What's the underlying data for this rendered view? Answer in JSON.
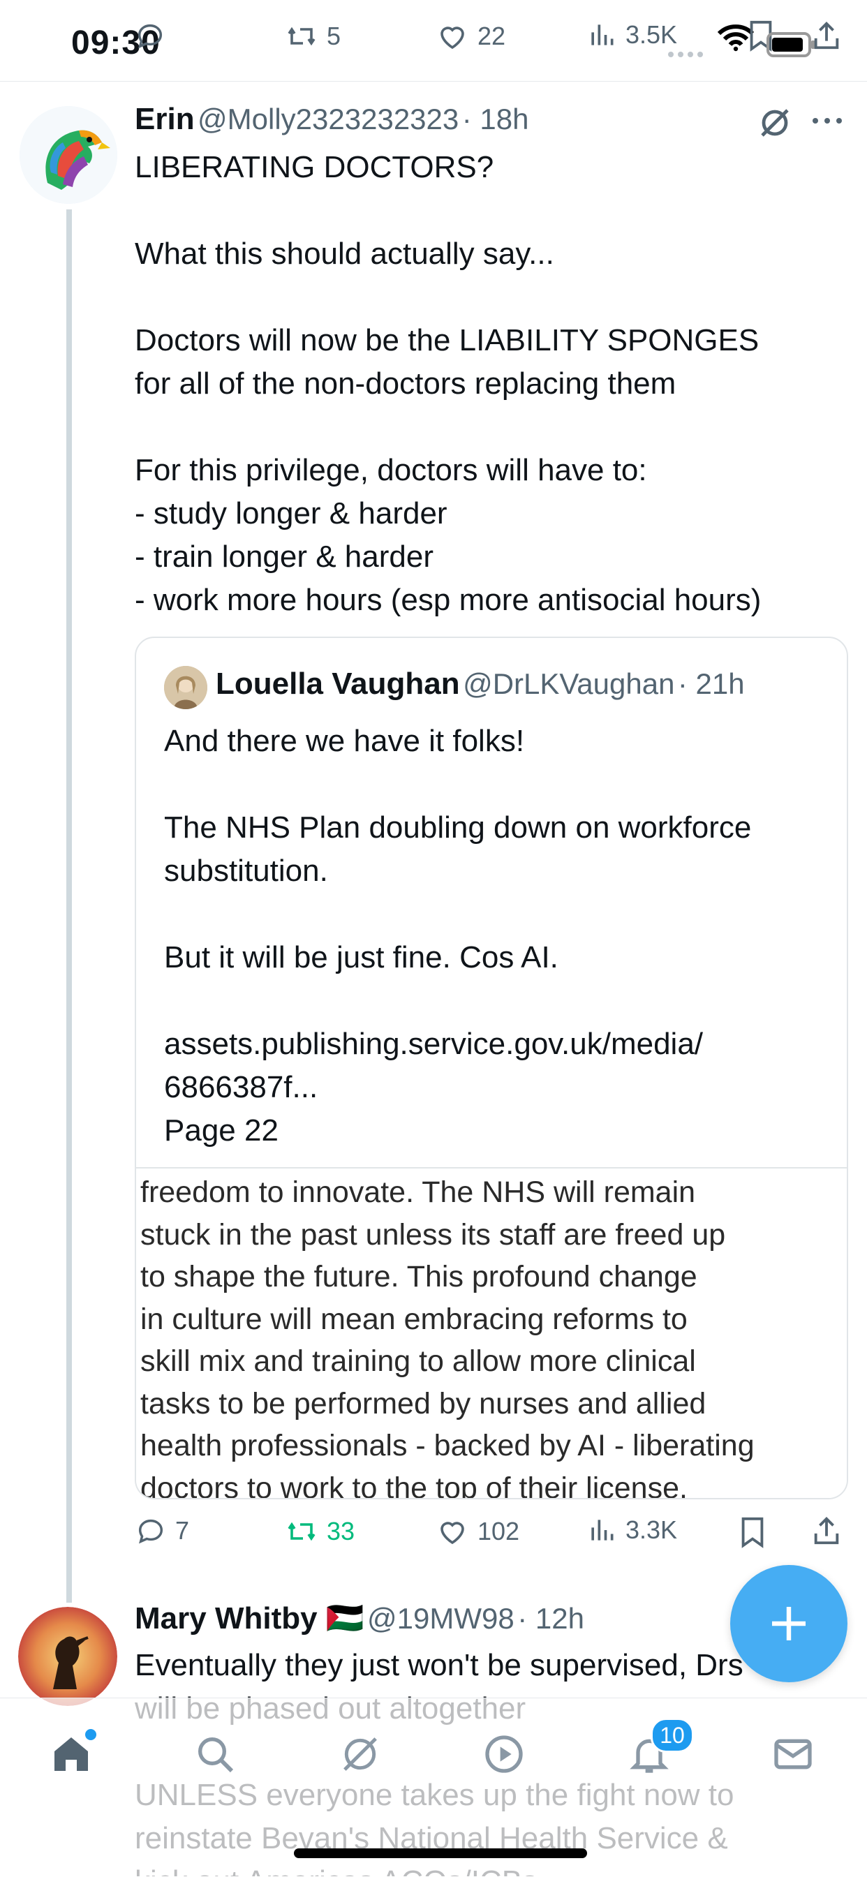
{
  "status_bar": {
    "time": "09:30"
  },
  "top_actions": {
    "retweets": "5",
    "likes": "22",
    "views": "3.5K"
  },
  "tweet": {
    "name": "Erin",
    "handle": "@Molly2323232323",
    "time": "· 18h",
    "text": "LIBERATING DOCTORS?\n\nWhat this should actually say...\n\nDoctors will now be the LIABILITY SPONGES\nfor all of the non-doctors replacing them\n\nFor this privilege, doctors will have to:\n- study longer & harder\n- train longer & harder\n- work more hours (esp more antisocial hours)",
    "quote": {
      "name": "Louella Vaughan",
      "handle": "@DrLKVaughan",
      "time": "· 21h",
      "text": "And there we have it folks!\n\nThe NHS Plan doubling down on workforce\nsubstitution.\n\nBut it will be just fine. Cos AI.\n\nassets.publishing.service.gov.uk/media/\n6866387f...\nPage 22",
      "image_text": "freedom to innovate. The NHS will remain\nstuck in the past unless its staff are freed up\nto shape the future. This profound change\nin culture will mean embracing reforms to\nskill mix and training to allow more clinical\ntasks to be performed by nurses and allied\nhealth professionals - backed by AI - liberating\ndoctors to work to the top of their license."
    },
    "actions": {
      "replies": "7",
      "retweets": "33",
      "likes": "102",
      "views": "3.3K"
    }
  },
  "reply": {
    "name": "Mary Whitby 🇵🇸",
    "handle": "@19MW98",
    "time": "· 12h",
    "text": "Eventually they just won't be supervised, Drs\nwill be phased out altogether\n\nUNLESS everyone takes up the fight now to\nreinstate Bevan's National Health Service &\nkick out Americas ACOs/ICBs"
  },
  "tabbar": {
    "notifications_badge": "10"
  },
  "colors": {
    "accent": "#1d9bf0",
    "retweet_green": "#00ba7c",
    "muted": "#536471"
  }
}
